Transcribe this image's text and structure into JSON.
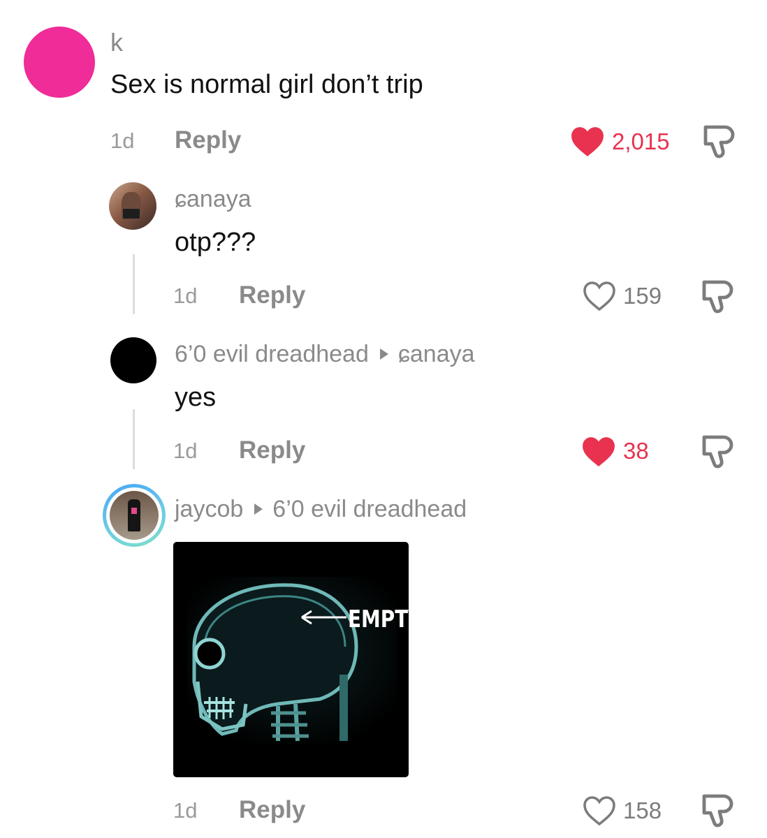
{
  "comments": [
    {
      "username": "k",
      "text": "Sex is normal girl don’t trip",
      "time": "1d",
      "reply_label": "Reply",
      "likes": "2,015",
      "liked": true,
      "avatar_color": "#ef2c97"
    },
    {
      "username": "ɕanaya",
      "text": "otp???",
      "time": "1d",
      "reply_label": "Reply",
      "likes": "159",
      "liked": false
    },
    {
      "username": "6’0 evil dreadhead",
      "reply_to": "ɕanaya",
      "text": "yes",
      "time": "1d",
      "reply_label": "Reply",
      "likes": "38",
      "liked": true,
      "avatar_color": "#000000"
    },
    {
      "username": "jaycob",
      "reply_to": "6’0 evil dreadhead",
      "image_text": "EMPTY",
      "time": "1d",
      "reply_label": "Reply",
      "likes": "158",
      "liked": false
    }
  ],
  "colors": {
    "like_active": "#e8324f",
    "secondary_text": "#8a8a8a",
    "story_ring": [
      "#43a6f5",
      "#7fe0c8"
    ]
  },
  "icons": [
    "heart-icon",
    "heart-outline-icon",
    "dislike-icon",
    "reply-arrow-icon"
  ]
}
